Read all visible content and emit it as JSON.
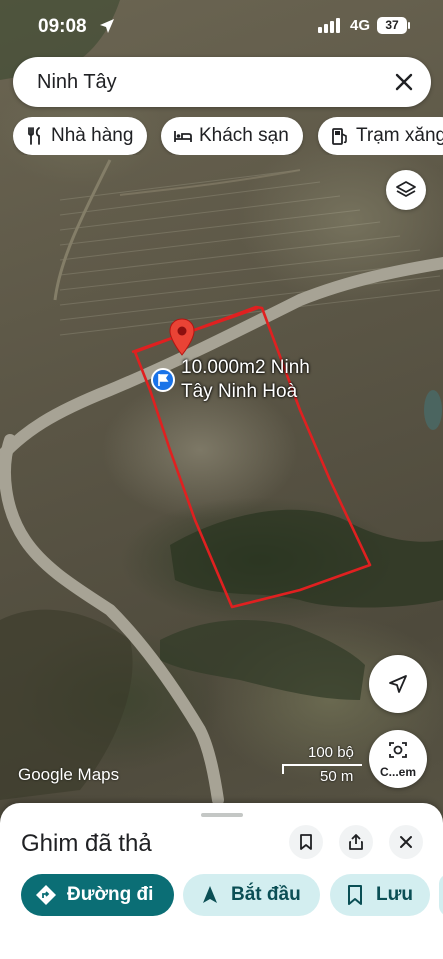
{
  "status_bar": {
    "time": "09:08",
    "network": "4G",
    "battery": "37"
  },
  "search": {
    "query": "Ninh Tây"
  },
  "chips": [
    {
      "label": "Nhà hàng",
      "icon": "restaurant-icon"
    },
    {
      "label": "Khách sạn",
      "icon": "hotel-icon"
    },
    {
      "label": "Trạm xăng",
      "icon": "gas-station-icon"
    }
  ],
  "map": {
    "pin_label": "10.000m2 Ninh Tây Ninh Hoà",
    "logo": "Google Maps",
    "scale_imperial": "100 bộ",
    "scale_metric": "50 m",
    "camera_label": "C...em"
  },
  "sheet": {
    "title": "Ghim đã thả",
    "actions": [
      {
        "label": "Đường đi",
        "icon": "directions-icon"
      },
      {
        "label": "Bắt đầu",
        "icon": "navigation-arrow-icon"
      },
      {
        "label": "Lưu",
        "icon": "bookmark-icon"
      }
    ]
  },
  "colors": {
    "accent": "#0b6e75",
    "accent_light": "#d3eef0",
    "pin": "#ea4335",
    "outline": "#e02020",
    "poi": "#1a73e8"
  }
}
